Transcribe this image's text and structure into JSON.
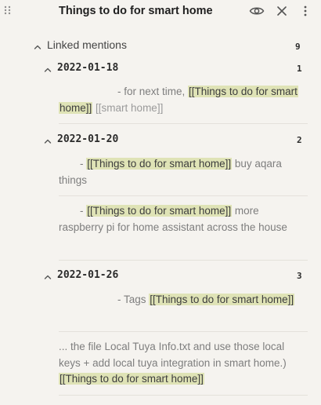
{
  "header": {
    "title": "Things to do for smart home",
    "icons": [
      "drag-handle-icon",
      "eye-icon",
      "close-icon",
      "more-vertical-icon"
    ]
  },
  "linked_mentions": {
    "label": "Linked mentions",
    "count": "9"
  },
  "groups": [
    {
      "date": "2022-01-18",
      "count": "1",
      "refs": [
        {
          "prefix": "- for next time,",
          "link": "[[Things to do for smart home]]",
          "suffix": "[[smart home]]"
        }
      ]
    },
    {
      "date": "2022-01-20",
      "count": "2",
      "refs": [
        {
          "prefix": "-",
          "link": "[[Things to do for smart home]]",
          "suffix": "buy aqara things"
        },
        {
          "prefix": "-",
          "link": "[[Things to do for smart home]]",
          "suffix": "more raspberry pi for home assistant across the house"
        }
      ]
    },
    {
      "date": "2022-01-26",
      "count": "3",
      "refs": [
        {
          "prefix": "- Tags",
          "link": "[[Things to do for smart home]]",
          "suffix": ""
        },
        {
          "prefix": "... the file Local Tuya Info.txt and use those local keys + add local tuya integration in smart home.)",
          "link": "[[Things to do for smart home]]",
          "suffix": ""
        }
      ]
    }
  ],
  "colors": {
    "background": "#f5f3ef",
    "link_highlight": "#dfe3b6",
    "text_muted": "#7e7e7e",
    "text_strong": "#2b2b2b"
  }
}
